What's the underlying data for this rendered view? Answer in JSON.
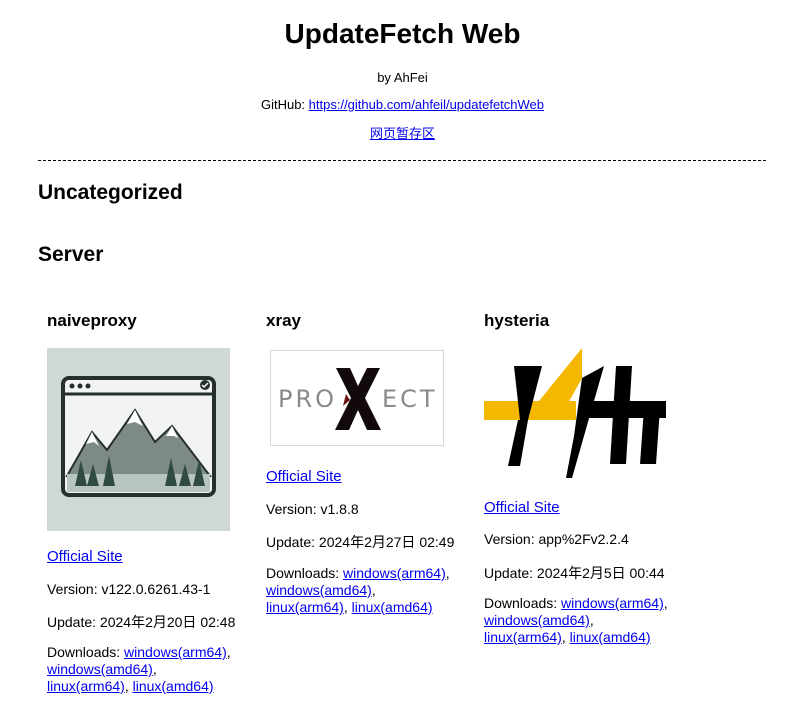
{
  "header": {
    "title": "UpdateFetch Web",
    "author": "by AhFei",
    "github_prefix": "GitHub: ",
    "github_url": "https://github.com/ahfeil/updatefetchWeb",
    "archive_link": "网页暂存区"
  },
  "sections": {
    "uncategorized": "Uncategorized",
    "server": "Server"
  },
  "cards": [
    {
      "name": "naiveproxy",
      "official_label": "Official Site",
      "version": "Version: v122.0.6261.43-1",
      "update": "Update: 2024年2月20日 02:48",
      "downloads_label": "Downloads: ",
      "downloads": [
        "windows(arm64)",
        "windows(amd64)",
        "linux(arm64)",
        "linux(amd64)"
      ],
      "icon": "mountain-browser-icon"
    },
    {
      "name": "xray",
      "official_label": "Official Site",
      "version": "Version: v1.8.8",
      "update": "Update: 2024年2月27日 02:49",
      "downloads_label": "Downloads: ",
      "downloads": [
        "windows(arm64)",
        "windows(amd64)",
        "linux(arm64)",
        "linux(amd64)"
      ],
      "logo_text": "PROXECT",
      "icon": "project-x-logo"
    },
    {
      "name": "hysteria",
      "official_label": "Official Site",
      "version": "Version: app%2Fv2.2.4",
      "update": "Update: 2024年2月5日 00:44",
      "downloads_label": "Downloads: ",
      "downloads": [
        "windows(arm64)",
        "windows(amd64)",
        "linux(arm64)",
        "linux(amd64)"
      ],
      "icon": "hysteria-logo"
    }
  ],
  "colors": {
    "link": "#0000ee",
    "hysteria_yellow": "#f5b800",
    "naive_bg": "#cfd8d6"
  }
}
